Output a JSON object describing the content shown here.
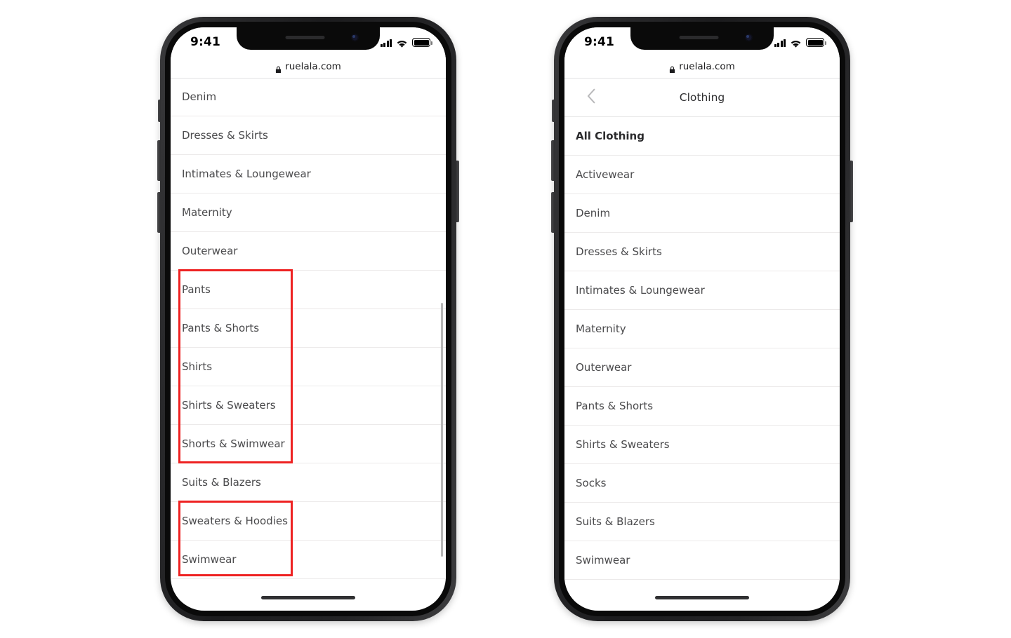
{
  "page": {
    "background": "#ffffff",
    "annotation_color": "#ee2222"
  },
  "phones": [
    {
      "id": "left",
      "status_bar": {
        "time": "9:41",
        "icons": [
          "cellular-signal-icon",
          "wifi-icon",
          "battery-icon"
        ]
      },
      "browser": {
        "lock_icon": "lock-icon",
        "url": "ruelala.com"
      },
      "nav": null,
      "list_items": [
        {
          "label": "Denim",
          "bold": false
        },
        {
          "label": "Dresses & Skirts",
          "bold": false
        },
        {
          "label": "Intimates & Loungewear",
          "bold": false
        },
        {
          "label": "Maternity",
          "bold": false
        },
        {
          "label": "Outerwear",
          "bold": false
        },
        {
          "label": "Pants",
          "bold": false
        },
        {
          "label": "Pants & Shorts",
          "bold": false
        },
        {
          "label": "Shirts",
          "bold": false
        },
        {
          "label": "Shirts & Sweaters",
          "bold": false
        },
        {
          "label": "Shorts & Swimwear",
          "bold": false
        },
        {
          "label": "Suits & Blazers",
          "bold": false
        },
        {
          "label": "Sweaters & Hoodies",
          "bold": false
        },
        {
          "label": "Swimwear",
          "bold": false
        }
      ],
      "scrollbar_visible": true,
      "home_indicator": true
    },
    {
      "id": "right",
      "status_bar": {
        "time": "9:41",
        "icons": [
          "cellular-signal-icon",
          "wifi-icon",
          "battery-icon"
        ]
      },
      "browser": {
        "lock_icon": "lock-icon",
        "url": "ruelala.com"
      },
      "nav": {
        "back_icon": "chevron-left-icon",
        "title": "Clothing"
      },
      "list_items": [
        {
          "label": "All Clothing",
          "bold": true
        },
        {
          "label": "Activewear",
          "bold": false
        },
        {
          "label": "Denim",
          "bold": false
        },
        {
          "label": "Dresses & Skirts",
          "bold": false
        },
        {
          "label": "Intimates & Loungewear",
          "bold": false
        },
        {
          "label": "Maternity",
          "bold": false
        },
        {
          "label": "Outerwear",
          "bold": false
        },
        {
          "label": "Pants & Shorts",
          "bold": false
        },
        {
          "label": "Shirts & Sweaters",
          "bold": false
        },
        {
          "label": "Socks",
          "bold": false
        },
        {
          "label": "Suits & Blazers",
          "bold": false
        },
        {
          "label": "Swimwear",
          "bold": false
        }
      ],
      "scrollbar_visible": false,
      "home_indicator": true
    }
  ],
  "annotations": [
    {
      "name": "highlight-pants-through-shorts-swimwear",
      "covers": [
        "Pants",
        "Pants & Shorts",
        "Shirts",
        "Shirts & Sweaters",
        "Shorts & Swimwear"
      ]
    },
    {
      "name": "highlight-sweaters-and-swimwear",
      "covers": [
        "Sweaters & Hoodies",
        "Swimwear"
      ]
    }
  ]
}
